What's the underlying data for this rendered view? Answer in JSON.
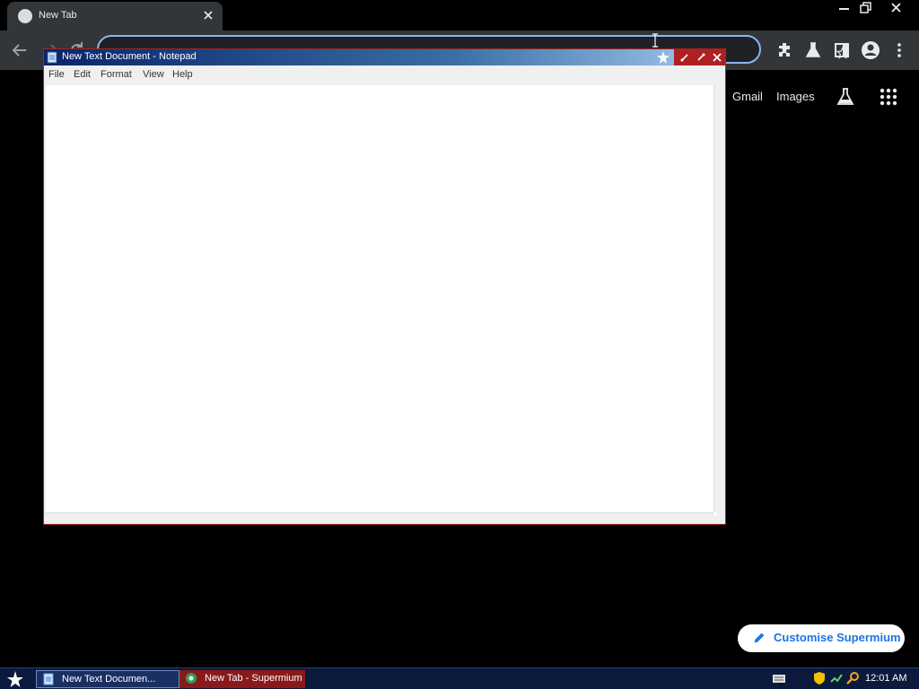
{
  "browser": {
    "tab": {
      "title": "New Tab",
      "close_icon": "close-icon",
      "favicon": "globe-icon"
    },
    "window_controls": [
      "minimize-icon",
      "restore-icon",
      "close-icon"
    ],
    "toolbar": {
      "icons": [
        "back-arrow-icon",
        "forward-arrow-icon",
        "reload-icon",
        "bookmark-star-icon",
        "extensions-icon",
        "labs-flask-icon",
        "side-panel-icon",
        "profile-icon",
        "kebab-menu-icon"
      ],
      "omnibox_value": "",
      "omnibox_placeholder": ""
    },
    "ntp": {
      "gmail": "Gmail",
      "images": "Images",
      "customise_label": "Customise Supermium"
    },
    "colors": {
      "omnibox_focus": "#8ab4f8",
      "customise_text": "#1a73e8",
      "toolbar_bg": "#323639"
    }
  },
  "notepad": {
    "title": "New Text Document - Notepad",
    "menu": {
      "file": "File",
      "edit": "Edit",
      "format": "Format",
      "view": "View",
      "help": "Help"
    },
    "content": ""
  },
  "taskbar": {
    "items": [
      {
        "label": "New Text Documen...",
        "icon": "notepad-icon"
      },
      {
        "label": "New Tab - Supermium",
        "icon": "browser-icon"
      }
    ],
    "tray_icons": [
      "keyboard-icon",
      "shield-icon",
      "network-icon",
      "search-icon"
    ],
    "clock": "12:01 AM"
  }
}
